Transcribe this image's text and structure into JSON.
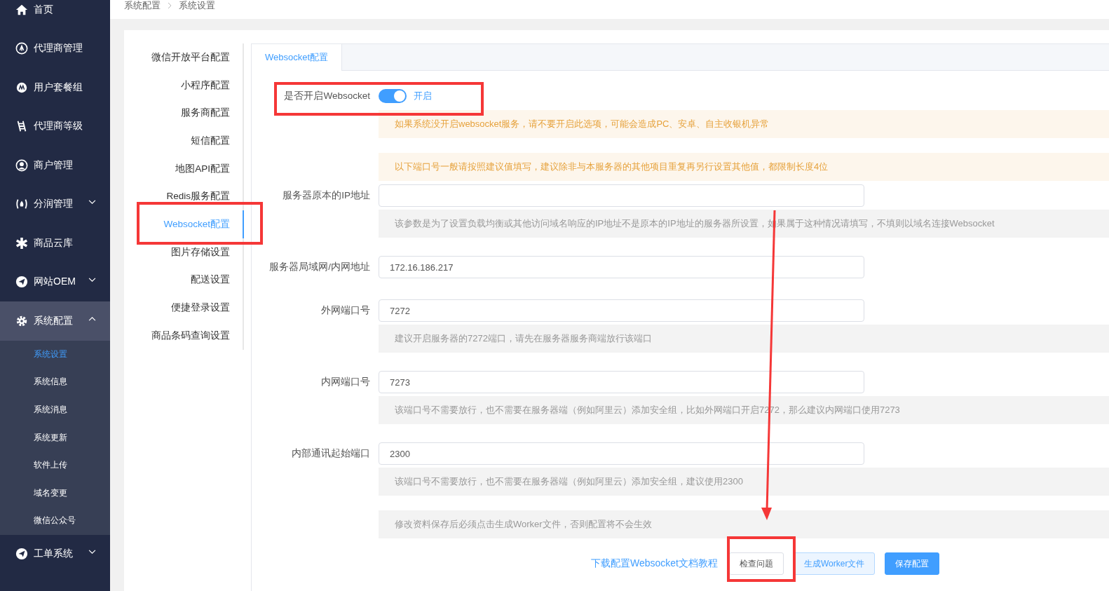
{
  "breadcrumb": [
    "系统配置",
    "系统设置"
  ],
  "sidebar": {
    "items": [
      {
        "label": "首页",
        "selected": false
      },
      {
        "label": "代理商管理",
        "selected": false
      },
      {
        "label": "用户套餐组",
        "selected": false
      },
      {
        "label": "代理商等级",
        "selected": false
      },
      {
        "label": "商户管理",
        "selected": false
      },
      {
        "label": "分润管理",
        "selected": false,
        "expanded": false
      },
      {
        "label": "商品云库",
        "selected": false
      },
      {
        "label": "网站OEM",
        "selected": false,
        "expanded": false
      },
      {
        "label": "系统配置",
        "selected": true,
        "expanded": true,
        "children": [
          {
            "label": "系统设置",
            "selected": true
          },
          {
            "label": "系统信息",
            "selected": false
          },
          {
            "label": "系统消息",
            "selected": false
          },
          {
            "label": "系统更新",
            "selected": false
          },
          {
            "label": "软件上传",
            "selected": false
          },
          {
            "label": "域名变更",
            "selected": false
          },
          {
            "label": "微信公众号",
            "selected": false
          }
        ]
      },
      {
        "label": "工单系统",
        "selected": false,
        "expanded": false
      }
    ]
  },
  "settings_menu": [
    {
      "label": "微信开放平台配置",
      "selected": false
    },
    {
      "label": "小程序配置",
      "selected": false
    },
    {
      "label": "服务商配置",
      "selected": false
    },
    {
      "label": "短信配置",
      "selected": false
    },
    {
      "label": "地图API配置",
      "selected": false
    },
    {
      "label": "Redis服务配置",
      "selected": false
    },
    {
      "label": "Websocket配置",
      "selected": true
    },
    {
      "label": "图片存储设置",
      "selected": false
    },
    {
      "label": "配送设置",
      "selected": false
    },
    {
      "label": "便捷登录设置",
      "selected": false
    },
    {
      "label": "商品条码查询设置",
      "selected": false
    }
  ],
  "tabs": [
    {
      "label": "Websocket配置",
      "selected": true
    }
  ],
  "form": [
    {
      "kind": "switch",
      "label": "是否开启Websocket",
      "on": true,
      "state_text": "开启"
    },
    {
      "kind": "warning",
      "text": "如果系统没开启websocket服务，请不要开启此选项，可能会造成PC、安卓、自主收银机异常"
    },
    {
      "kind": "warning",
      "text": "以下端口号一般请按照建议值填写，建议除非与本服务器的其他项目重复再另行设置其他值，都限制长度4位"
    },
    {
      "kind": "input",
      "label": "服务器原本的IP地址"
    },
    {
      "kind": "hint",
      "text": "该参数是为了设置负载均衡或其他访问域名响应的IP地址不是原本的IP地址的服务器所设置，如果属于这种情况请填写，不填则以域名连接Websocket"
    },
    {
      "kind": "input",
      "label": "服务器局域网/内网地址",
      "value": "172.16.186.217"
    },
    {
      "kind": "input",
      "label": "外网端口号",
      "value": "7272"
    },
    {
      "kind": "hint",
      "text": "建议开启服务器的7272端口，请先在服务器服务商端放行该端口"
    },
    {
      "kind": "input",
      "label": "内网端口号",
      "value": "7273"
    },
    {
      "kind": "hint",
      "text": "该端口号不需要放行，也不需要在服务器端（例如阿里云）添加安全组，比如外网端口开启7272，那么建议内网端口使用7273"
    },
    {
      "kind": "input",
      "label": "内部通讯起始端口",
      "value": "2300"
    },
    {
      "kind": "hint",
      "text": "该端口号不需要放行，也不需要在服务器端（例如阿里云）添加安全组，建议使用2300"
    },
    {
      "kind": "hint",
      "text": "修改资料保存后必须点击生成Worker文件，否则配置将不会生效"
    }
  ],
  "actions": {
    "link": "下载配置Websocket文档教程",
    "buttons": [
      {
        "label": "检查问题",
        "kind": "default"
      },
      {
        "label": "生成Worker文件",
        "kind": "plain"
      },
      {
        "label": "保存配置",
        "kind": "primary"
      }
    ]
  }
}
